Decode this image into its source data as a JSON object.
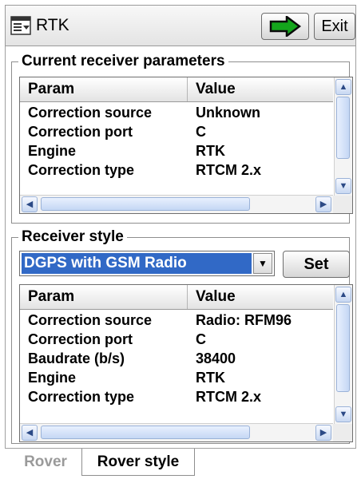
{
  "window": {
    "title": "RTK",
    "next_icon": "arrow-right-icon",
    "exit_label": "Exit"
  },
  "current_params": {
    "group_label": "Current receiver parameters",
    "columns": [
      "Param",
      "Value"
    ],
    "rows": [
      {
        "param": "Correction source",
        "value": "Unknown"
      },
      {
        "param": "Correction port",
        "value": "C"
      },
      {
        "param": "Engine",
        "value": "RTK"
      },
      {
        "param": "Correction type",
        "value": "RTCM 2.x"
      }
    ]
  },
  "receiver_style": {
    "group_label": "Receiver style",
    "selected": "DGPS with GSM Radio",
    "set_label": "Set",
    "columns": [
      "Param",
      "Value"
    ],
    "rows": [
      {
        "param": "Correction source",
        "value": "Radio: RFM96"
      },
      {
        "param": "Correction port",
        "value": "C"
      },
      {
        "param": "Baudrate (b/s)",
        "value": "38400"
      },
      {
        "param": "Engine",
        "value": "RTK"
      },
      {
        "param": "Correction type",
        "value": "RTCM 2.x"
      }
    ]
  },
  "tabs": [
    {
      "label": "Rover",
      "active": false
    },
    {
      "label": "Rover style",
      "active": true
    }
  ],
  "colors": {
    "selection": "#3169c6",
    "arrow": "#0a0a0a",
    "arrow_fill": "#14a51c"
  }
}
